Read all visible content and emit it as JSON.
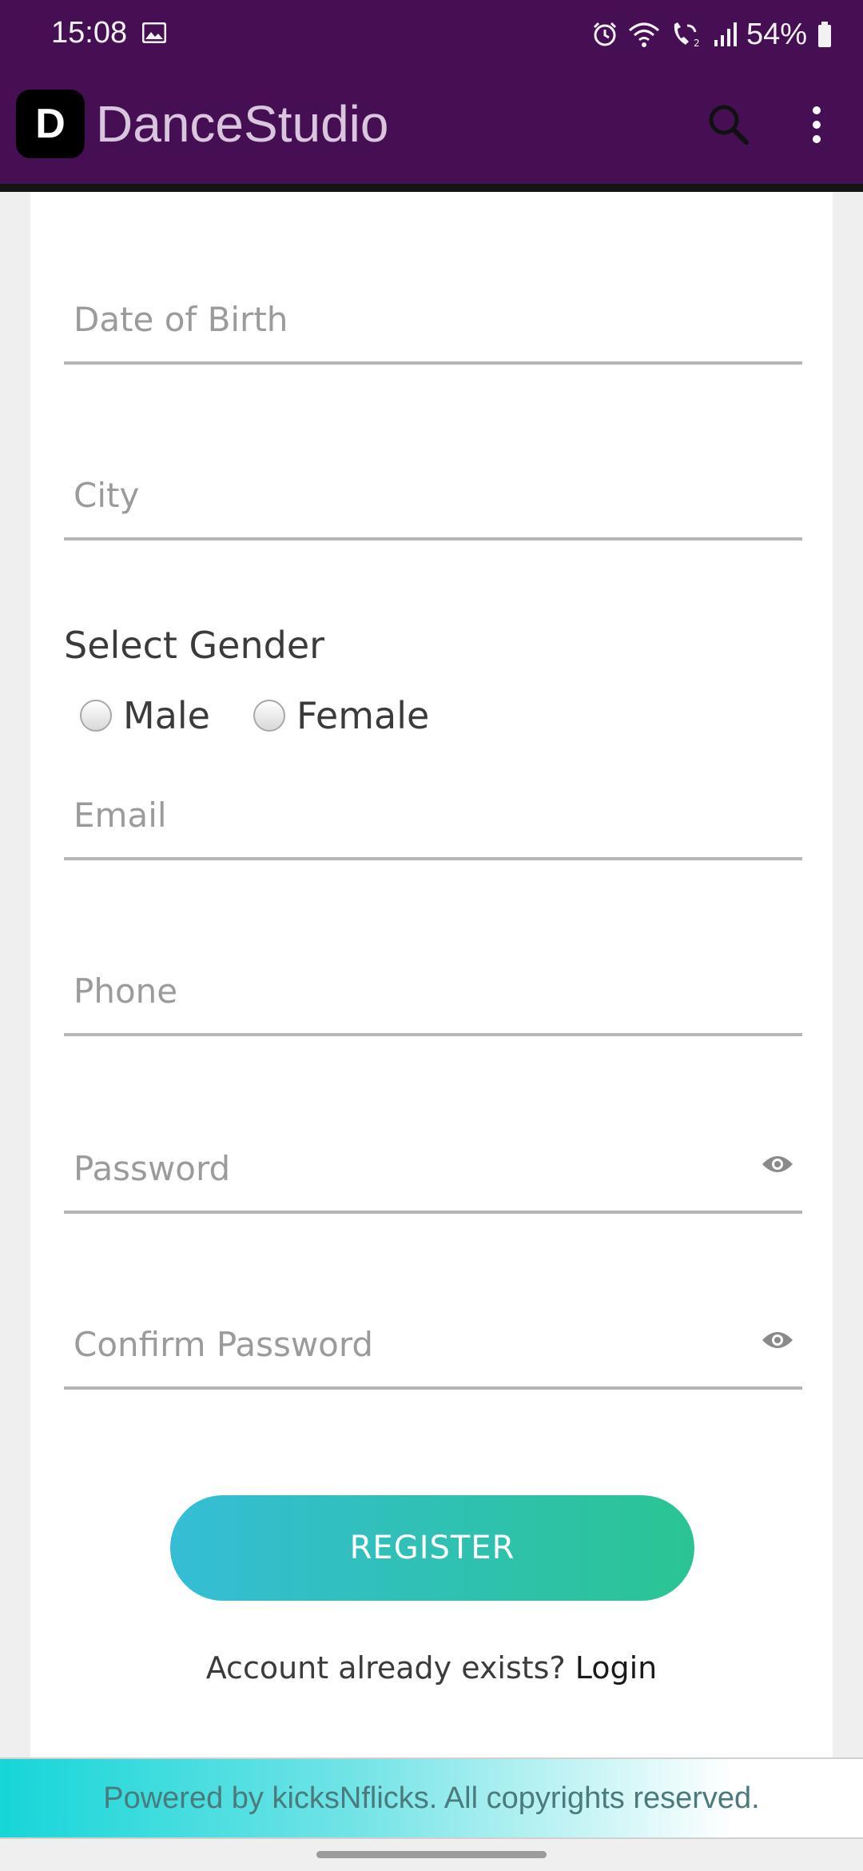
{
  "status_bar": {
    "time": "15:08",
    "battery": "54%",
    "icons": [
      "image-icon",
      "alarm-icon",
      "wifi-icon",
      "wifi-calling-icon",
      "signal-icon",
      "battery-icon"
    ]
  },
  "app_bar": {
    "logo_letter": "D",
    "title": "DanceStudio",
    "icons": [
      "search-icon",
      "more-vert-icon"
    ]
  },
  "form": {
    "dob_placeholder": "Date of Birth",
    "city_placeholder": "City",
    "gender": {
      "title": "Select Gender",
      "options": [
        "Male",
        "Female"
      ]
    },
    "email_placeholder": "Email",
    "phone_placeholder": "Phone",
    "password_placeholder": "Password",
    "confirm_password_placeholder": "Confirm Password",
    "register_label": "REGISTER",
    "account_exists_text": "Account already exists?",
    "login_link": "Login"
  },
  "footer": {
    "text": "Powered by kicksNflicks. All copyrights reserved."
  },
  "colors": {
    "app_bar": "#470f53",
    "button_start": "#35bdd6",
    "button_end": "#2ac493",
    "footer_start": "#16d6d8"
  }
}
